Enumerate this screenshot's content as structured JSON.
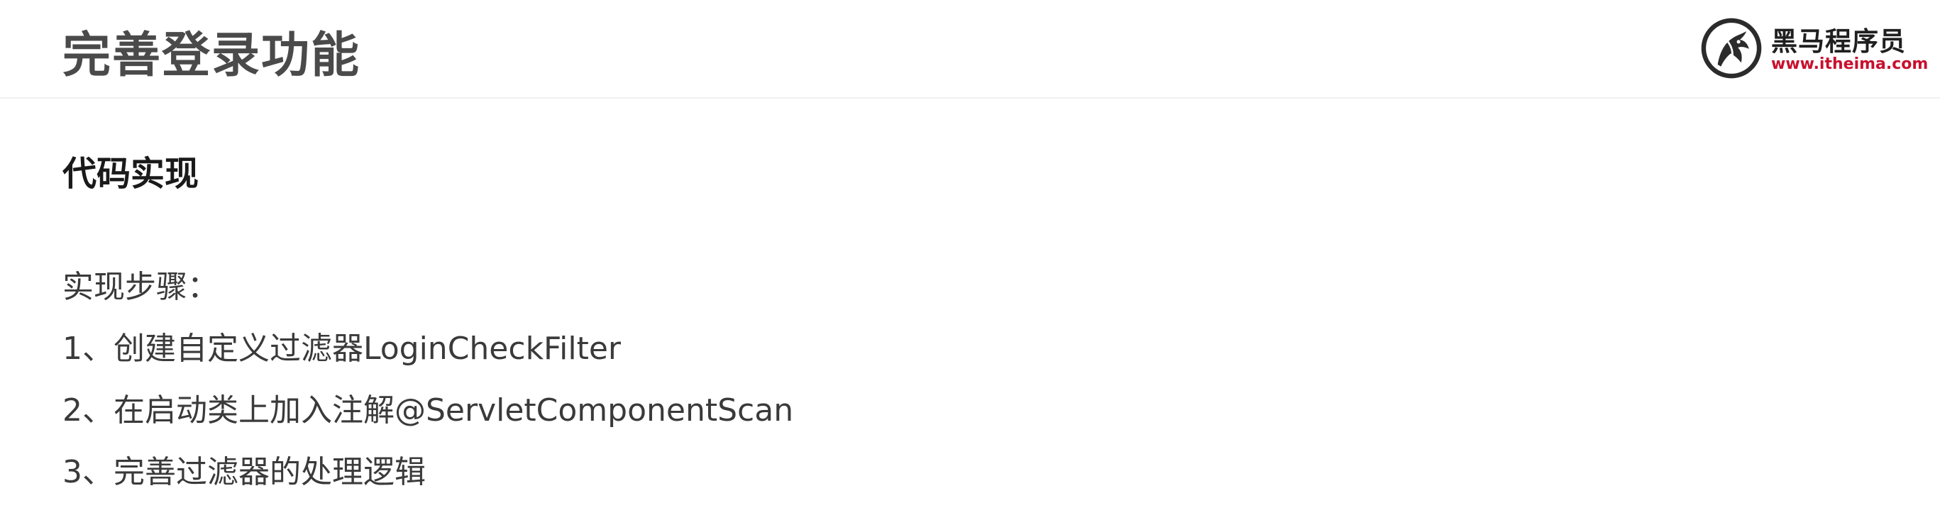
{
  "header": {
    "title": "完善登录功能",
    "logo": {
      "name_cn": "黑马程序员",
      "url": "www.itheima.com"
    }
  },
  "content": {
    "section_heading": "代码实现",
    "steps_label": "实现步骤：",
    "steps": [
      "1、创建自定义过滤器LoginCheckFilter",
      "2、在启动类上加入注解@ServletComponentScan",
      "3、完善过滤器的处理逻辑"
    ]
  },
  "colors": {
    "title_text": "#4a4a4a",
    "body_text": "#3a3a3a",
    "logo_url": "#c8102e",
    "background": "#ffffff"
  }
}
